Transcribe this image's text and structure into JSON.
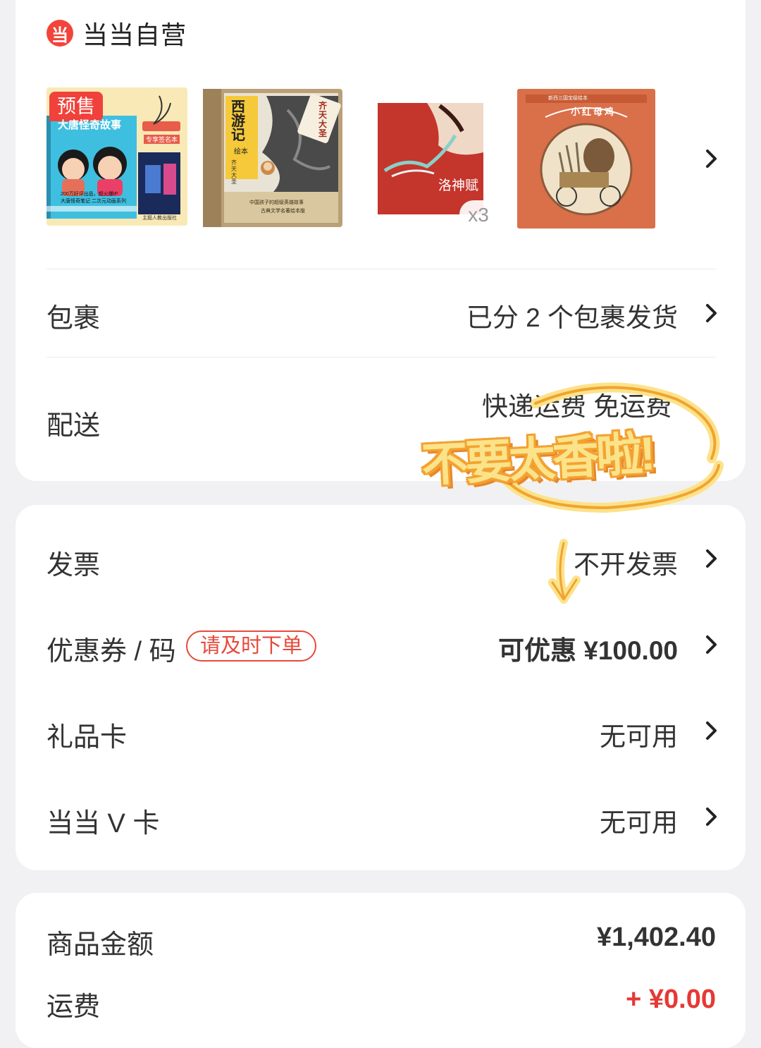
{
  "shop": {
    "logo_glyph": "当",
    "name": "当当自营",
    "brand_color": "#f2443a"
  },
  "products": {
    "items": [
      {
        "badge": "预售",
        "title": "大唐怪奇故事",
        "sign_tag": "专享签名本",
        "line1": "200万好评出品，超火爆IP",
        "line2": "大唐怪奇笔记 二次元动画系列",
        "publisher": "主题人教出版社"
      },
      {
        "title_main": "西游记",
        "subtitle": "绘本",
        "stamp": "齐天大圣",
        "banner": "中国孩子的超级英雄故事",
        "series": "古典文学名著绘本版",
        "badge": "齐天大圣"
      },
      {
        "title": "洛神赋",
        "quantity": "x3"
      },
      {
        "title": "小红母鸡",
        "series": "新西兰国宝级绘本"
      }
    ]
  },
  "rows": {
    "package": {
      "label": "包裹",
      "value": "已分 2 个包裹发货"
    },
    "delivery": {
      "label": "配送",
      "value": "快递运费 免运费"
    },
    "invoice": {
      "label": "发票",
      "value": "不开发票"
    },
    "coupon": {
      "label": "优惠券 / 码",
      "tag": "请及时下单",
      "value": "可优惠 ¥100.00"
    },
    "gift_card": {
      "label": "礼品卡",
      "value": "无可用"
    },
    "vcard": {
      "label": "当当 V 卡",
      "value": "无可用"
    }
  },
  "sticker": {
    "text": "不要太香啦!"
  },
  "summary": {
    "goods_amount": {
      "label": "商品金额",
      "value": "¥1,402.40"
    },
    "shipping": {
      "label": "运费",
      "value": "+ ¥0.00"
    }
  },
  "colors": {
    "accent_red": "#e53935",
    "sticker_yellow": "#fbe38a",
    "sticker_orange": "#f3a232"
  }
}
